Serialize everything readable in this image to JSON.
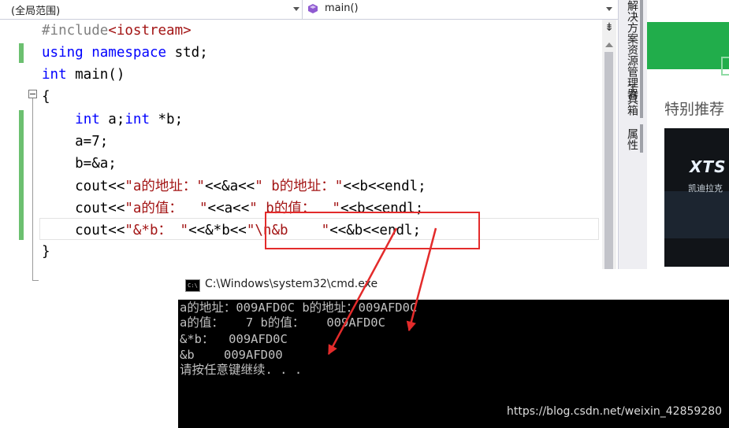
{
  "navbar": {
    "scope_dropdown": "(全局范围)",
    "member_dropdown": "main()"
  },
  "editor": {
    "code_lines": [
      [
        {
          "t": "#include",
          "c": "pp"
        },
        {
          "t": "<iostream>",
          "c": "str"
        }
      ],
      [
        {
          "t": "using",
          "c": "kw"
        },
        {
          "t": " "
        },
        {
          "t": "namespace",
          "c": "kw"
        },
        {
          "t": " std;"
        }
      ],
      [
        {
          "t": "int",
          "c": "kw"
        },
        {
          "t": " main()"
        }
      ],
      [
        {
          "t": "{"
        }
      ],
      [
        {
          "t": "    "
        },
        {
          "t": "int",
          "c": "kw"
        },
        {
          "t": " a;"
        },
        {
          "t": "int",
          "c": "kw"
        },
        {
          "t": " *b;"
        }
      ],
      [
        {
          "t": "    a=7;"
        }
      ],
      [
        {
          "t": "    b=&a;"
        }
      ],
      [
        {
          "t": "    cout<<"
        },
        {
          "t": "\"a的地址：\"",
          "c": "str"
        },
        {
          "t": "<<&a<<"
        },
        {
          "t": "\" b的地址：\"",
          "c": "str"
        },
        {
          "t": "<<b<<endl;"
        }
      ],
      [
        {
          "t": "    cout<<"
        },
        {
          "t": "\"a的值：  \"",
          "c": "str"
        },
        {
          "t": "<<a<<"
        },
        {
          "t": "\" b的值：  \"",
          "c": "str"
        },
        {
          "t": "<<b<<endl;"
        }
      ],
      [
        {
          "t": "    cout<<"
        },
        {
          "t": "\"&*b： \"",
          "c": "str"
        },
        {
          "t": "<<&*b<<"
        },
        {
          "t": "\"\\n&b    \"",
          "c": "str"
        },
        {
          "t": "<<&b<<endl;"
        }
      ],
      [
        {
          "t": "}"
        }
      ]
    ]
  },
  "side_panel": {
    "tabs": [
      "解决方案资源管理器",
      "工具箱",
      "属性"
    ]
  },
  "browser": {
    "recommend_label": "特别推荐",
    "ad_logo": "XTS",
    "ad_sub": "凯迪拉克"
  },
  "console": {
    "title": "C:\\Windows\\system32\\cmd.exe",
    "icon_label": "C:\\",
    "lines": [
      "a的地址：009AFD0C b的地址：009AFD0C",
      "a的值：   7 b的值：   009AFD0C",
      "&*b：  009AFD0C",
      "&b    009AFD00",
      "请按任意键继续. . ."
    ],
    "watermark": "https://blog.csdn.net/weixin_42859280"
  },
  "colors": {
    "keyword": "#0000ff",
    "string": "#a31515",
    "annotation": "#e32b2b",
    "change_marker": "#6cc070"
  }
}
